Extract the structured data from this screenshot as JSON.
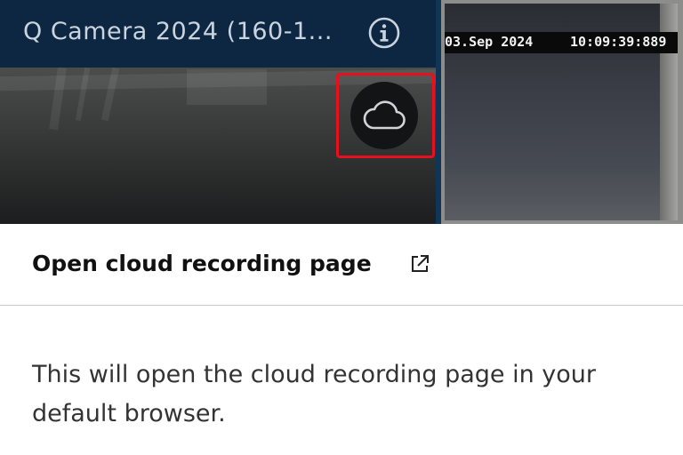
{
  "camera_left": {
    "title": "Q Camera 2024 (160-1...",
    "info_icon": "info-circle-icon",
    "cloud_button_icon": "cloud-icon"
  },
  "camera_right": {
    "timestamp_date": "03.Sep 2024",
    "timestamp_time": "10:09:39:889"
  },
  "dialog": {
    "title": "Open cloud recording page",
    "title_icon": "external-link-icon",
    "body": "This will open the cloud recording page in your default browser."
  },
  "colors": {
    "highlight": "#e8101c",
    "header_bg": "#0d2742"
  }
}
